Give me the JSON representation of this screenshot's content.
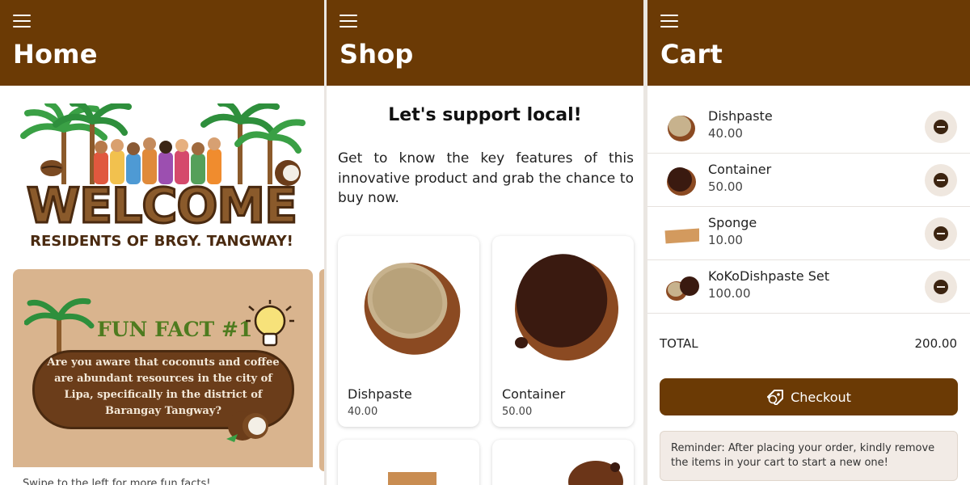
{
  "home": {
    "title": "Home",
    "menu_icon": "hamburger-menu-icon",
    "banner": {
      "headline": "WELCOME",
      "subheadline": "RESIDENTS OF BRGY. TANGWAY!"
    },
    "fun_fact": {
      "title": "FUN FACT #1",
      "text": "Are you aware that coconuts and coffee are abundant resources in the city of Lipa, specifically in the district of Barangay Tangway?",
      "swipe_hint": "Swipe to the left for more fun facts!"
    }
  },
  "shop": {
    "title": "Shop",
    "heading": "Let's support local!",
    "description": "Get to know the key features of this innovative product and grab the chance to buy now.",
    "products": [
      {
        "name": "Dishpaste",
        "price": "40.00"
      },
      {
        "name": "Container",
        "price": "50.00"
      }
    ]
  },
  "cart": {
    "title": "Cart",
    "items": [
      {
        "name": "Dishpaste",
        "price": "40.00"
      },
      {
        "name": "Container",
        "price": "50.00"
      },
      {
        "name": "Sponge",
        "price": "10.00"
      },
      {
        "name": "KoKoDishpaste Set",
        "price": "100.00"
      }
    ],
    "total_label": "TOTAL",
    "total_value": "200.00",
    "checkout_label": "Checkout",
    "reminder": "Reminder: After placing your order, kindly remove the items in your cart to start a new one!"
  },
  "colors": {
    "brand_brown": "#6b3a05",
    "card_tan": "#d9b48e",
    "fun_fact_green": "#4e7b1f"
  }
}
